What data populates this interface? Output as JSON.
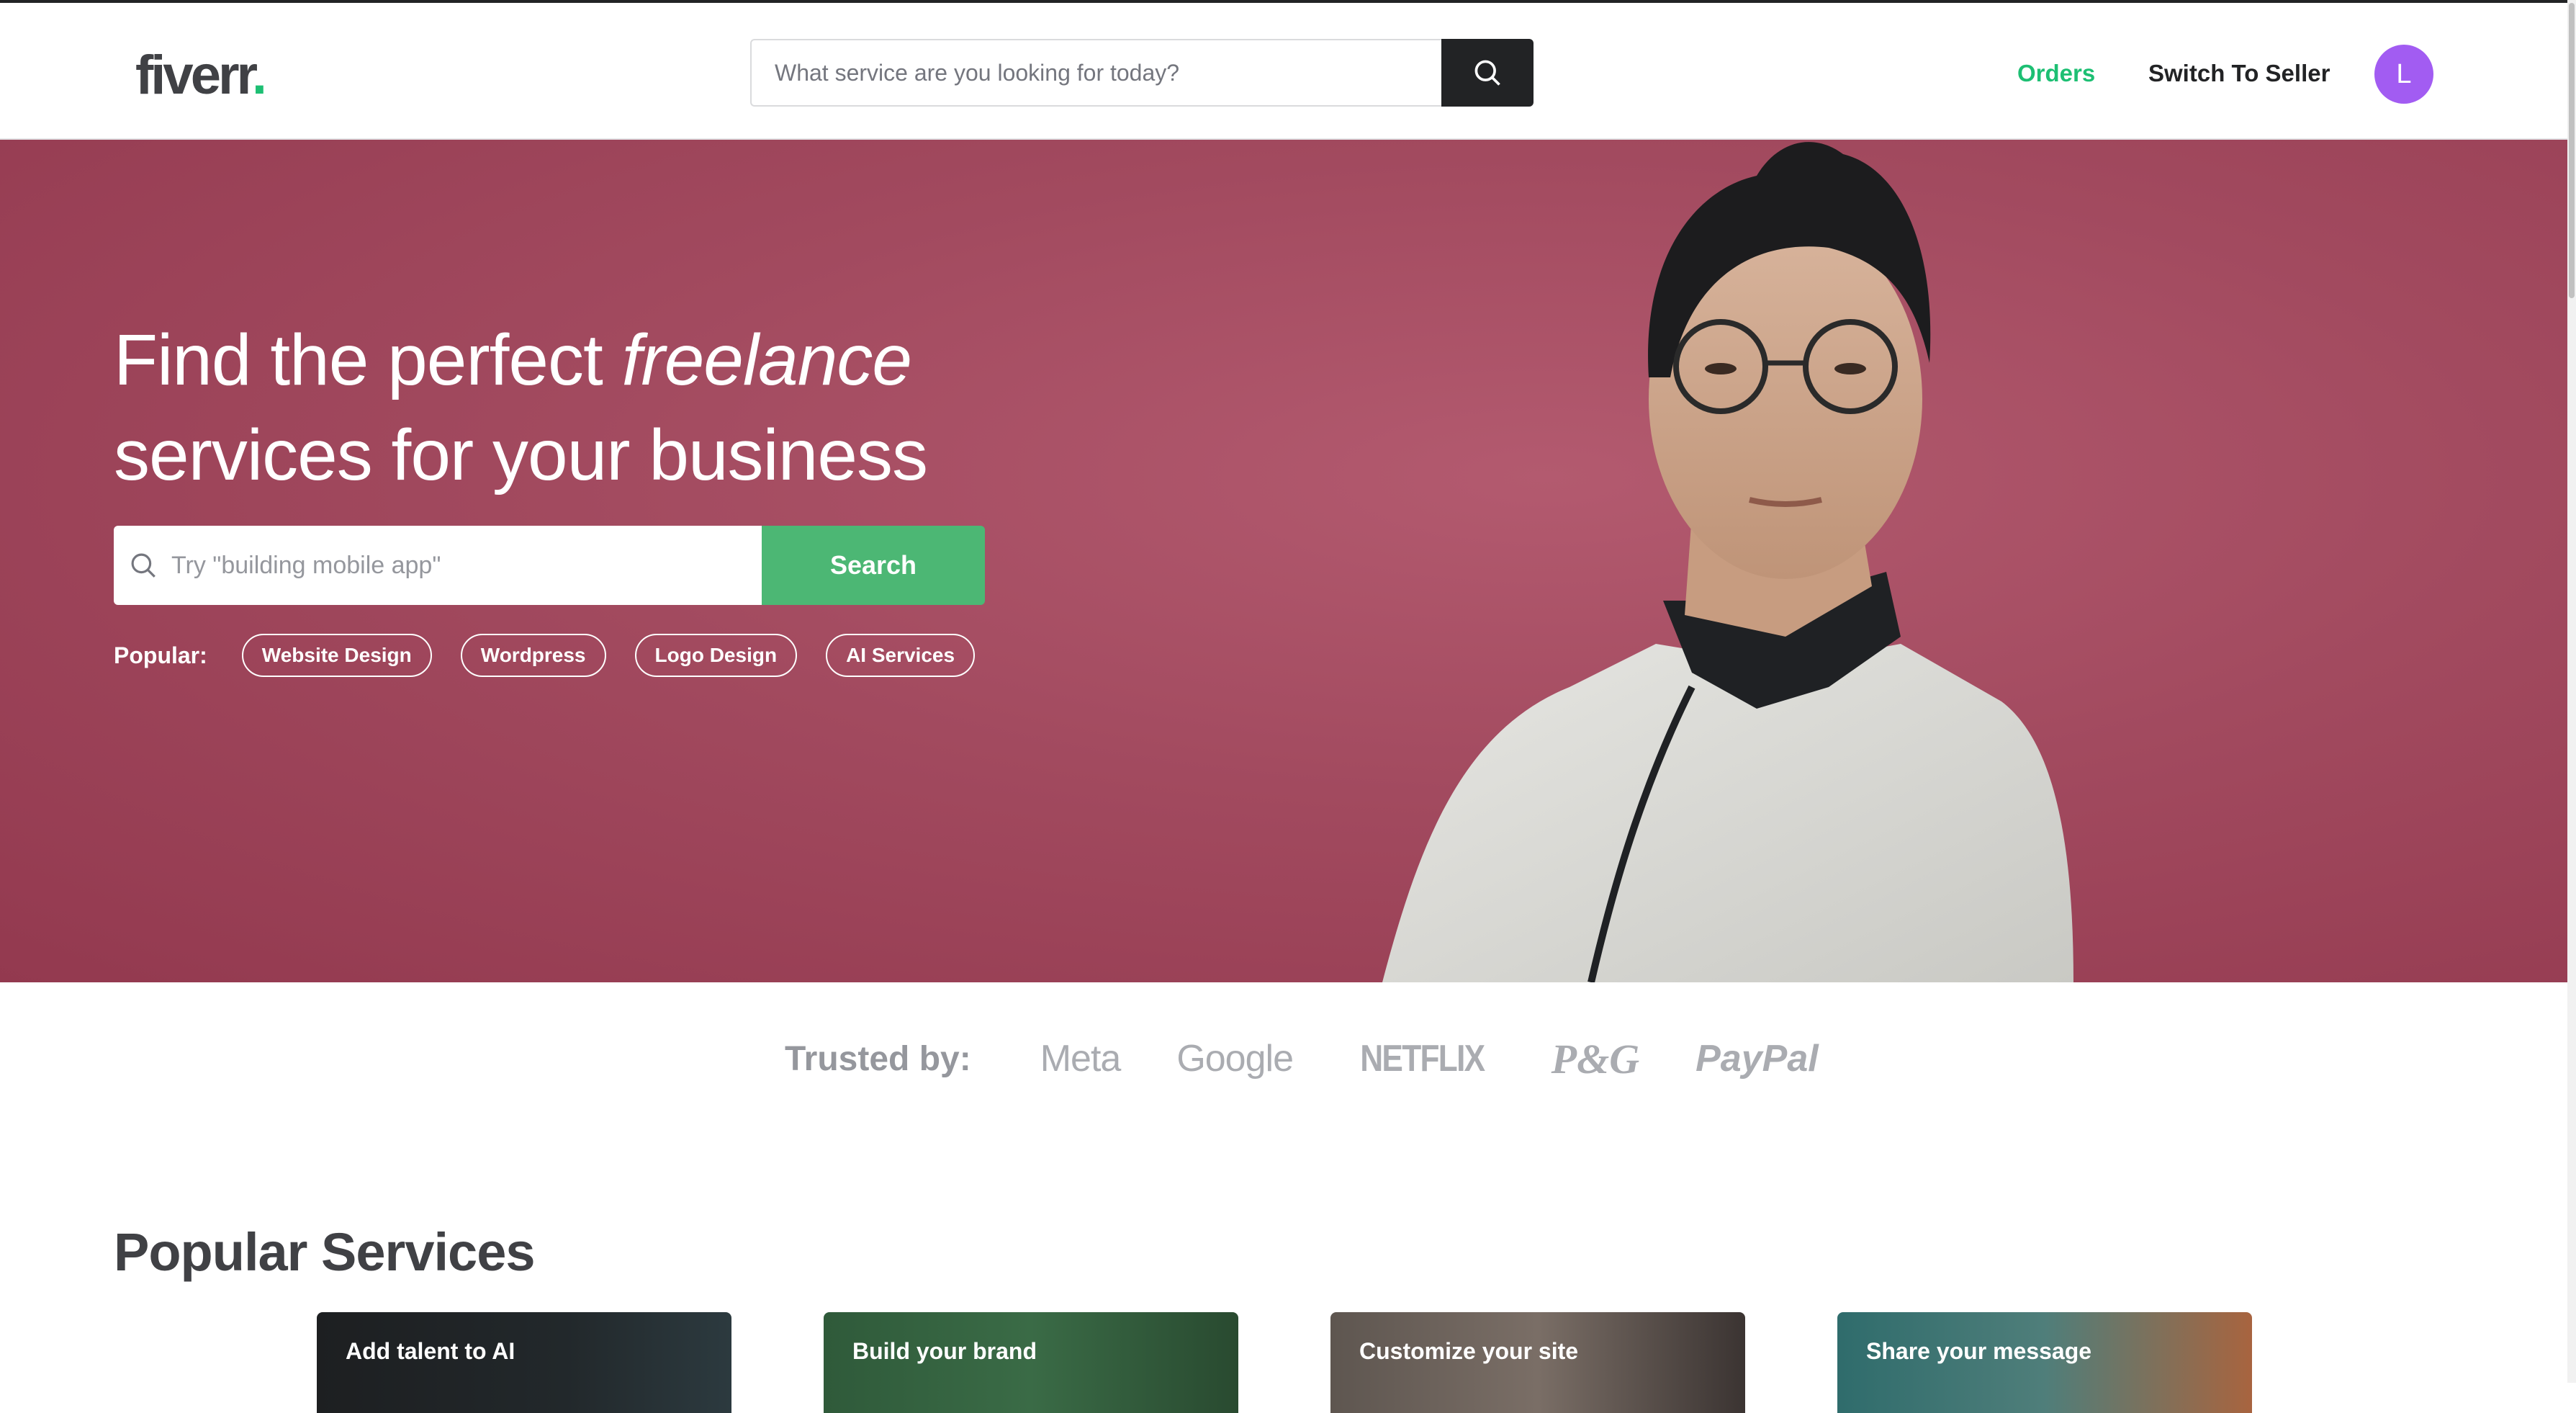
{
  "header": {
    "logo_text": "fiverr",
    "logo_dot": ".",
    "search_placeholder": "What service are you looking for today?",
    "orders_label": "Orders",
    "switch_label": "Switch To Seller",
    "avatar_initial": "L"
  },
  "hero": {
    "title_part1": "Find the perfect ",
    "title_italic": "freelance",
    "title_part2": "services for your business",
    "search_placeholder": "Try \"building mobile app\"",
    "search_button": "Search",
    "popular_label": "Popular:",
    "popular_tags": [
      "Website Design",
      "Wordpress",
      "Logo Design",
      "AI Services"
    ]
  },
  "trusted": {
    "label": "Trusted by:",
    "brands": [
      "Meta",
      "Google",
      "NETFLIX",
      "P&G",
      "PayPal"
    ]
  },
  "popular_services": {
    "title": "Popular Services",
    "cards": [
      {
        "label": "Add talent to AI"
      },
      {
        "label": "Build your brand"
      },
      {
        "label": "Customize your site"
      },
      {
        "label": "Share your message"
      }
    ]
  },
  "colors": {
    "brand_green": "#1dbf73",
    "hero_bg": "#a0485c",
    "search_button_green": "#4cb774",
    "avatar_purple": "#a25cf2",
    "dark": "#222325"
  }
}
